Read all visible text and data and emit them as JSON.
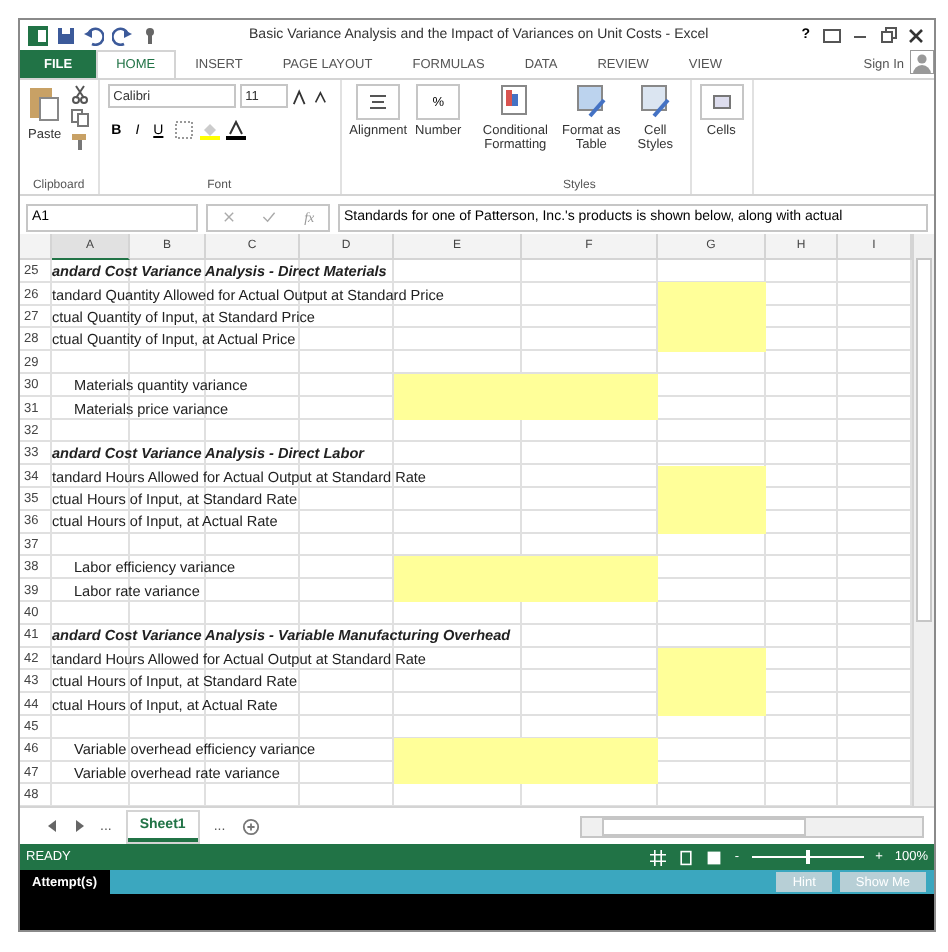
{
  "window": {
    "title": "Basic Variance Analysis and the Impact of Variances on Unit Costs - Excel",
    "help": "?"
  },
  "ribbon_tabs": [
    {
      "label": "FILE",
      "kind": "file",
      "selected": false
    },
    {
      "label": "HOME",
      "kind": "tab",
      "selected": true
    },
    {
      "label": "INSERT",
      "kind": "tab",
      "selected": false
    },
    {
      "label": "PAGE LAYOUT",
      "kind": "tab",
      "selected": false
    },
    {
      "label": "FORMULAS",
      "kind": "tab",
      "selected": false
    },
    {
      "label": "DATA",
      "kind": "tab",
      "selected": false
    },
    {
      "label": "REVIEW",
      "kind": "tab",
      "selected": false
    },
    {
      "label": "VIEW",
      "kind": "tab",
      "selected": false
    }
  ],
  "sign_in": "Sign In",
  "ribbon": {
    "paste": "Paste",
    "clipboard": "Clipboard",
    "font_name": "Calibri",
    "font_size": "11",
    "bold": "B",
    "italic": "I",
    "underline": "U",
    "font": "Font",
    "alignment": "Alignment",
    "number": "Number",
    "percent": "%",
    "conditional": "Conditional Formatting",
    "format_table": "Format as Table",
    "cell_styles": "Cell Styles",
    "styles": "Styles",
    "cells": "Cells"
  },
  "formula_bar": {
    "name_box": "A1",
    "fx": "fx",
    "formula": "Standards for one of Patterson, Inc.'s products is shown below, along with actual"
  },
  "columns": [
    "A",
    "B",
    "C",
    "D",
    "E",
    "F",
    "G",
    "H",
    "I"
  ],
  "rows": [
    {
      "number": "25",
      "kind": "heading",
      "text": "andard Cost Variance Analysis - Direct Materials"
    },
    {
      "number": "26",
      "kind": "line",
      "text": "tandard Quantity Allowed for Actual Output at Standard Price",
      "input": true
    },
    {
      "number": "27",
      "kind": "line",
      "text": "ctual Quantity of Input, at Standard Price",
      "input": true
    },
    {
      "number": "28",
      "kind": "line",
      "text": "ctual Quantity of Input, at Actual Price",
      "input": true
    },
    {
      "number": "29",
      "kind": "blank"
    },
    {
      "number": "30",
      "kind": "variance",
      "text": "Materials quantity variance",
      "input": true
    },
    {
      "number": "31",
      "kind": "variance",
      "text": "Materials price variance",
      "input": true
    },
    {
      "number": "32",
      "kind": "blank"
    },
    {
      "number": "33",
      "kind": "heading",
      "text": "andard Cost Variance Analysis - Direct Labor"
    },
    {
      "number": "34",
      "kind": "line",
      "text": "tandard Hours Allowed for Actual Output at Standard Rate",
      "input": true
    },
    {
      "number": "35",
      "kind": "line",
      "text": "ctual Hours of Input, at Standard Rate",
      "input": true
    },
    {
      "number": "36",
      "kind": "line",
      "text": "ctual Hours of Input, at Actual Rate",
      "input": true
    },
    {
      "number": "37",
      "kind": "blank"
    },
    {
      "number": "38",
      "kind": "variance",
      "text": "Labor efficiency variance",
      "input": true
    },
    {
      "number": "39",
      "kind": "variance",
      "text": "Labor rate variance",
      "input": true
    },
    {
      "number": "40",
      "kind": "blank"
    },
    {
      "number": "41",
      "kind": "heading",
      "text": "andard Cost Variance Analysis - Variable Manufacturing Overhead"
    },
    {
      "number": "42",
      "kind": "line",
      "text": "tandard Hours Allowed for Actual Output at Standard Rate",
      "input": true
    },
    {
      "number": "43",
      "kind": "line",
      "text": "ctual Hours of Input, at Standard Rate",
      "input": true
    },
    {
      "number": "44",
      "kind": "line",
      "text": "ctual Hours of Input, at Actual Rate",
      "input": true
    },
    {
      "number": "45",
      "kind": "blank"
    },
    {
      "number": "46",
      "kind": "variance",
      "text": "Variable overhead efficiency variance",
      "input": true
    },
    {
      "number": "47",
      "kind": "variance",
      "text": "Variable overhead rate variance",
      "input": true
    },
    {
      "number": "48",
      "kind": "blank"
    }
  ],
  "sheet_tabs": {
    "more_left": "...",
    "sheets": [
      {
        "label": "Sheet1",
        "selected": true
      }
    ],
    "more_right": "..."
  },
  "status_bar": {
    "status": "READY",
    "zoom_minus": "-",
    "zoom_plus": "+",
    "zoom": "100%",
    "level": 0.5
  },
  "attempt_bar": {
    "label": "Attempt(s)",
    "buttons": [
      {
        "label": "Hint",
        "disabled": true
      },
      {
        "label": "Show Me",
        "disabled": true
      }
    ]
  }
}
